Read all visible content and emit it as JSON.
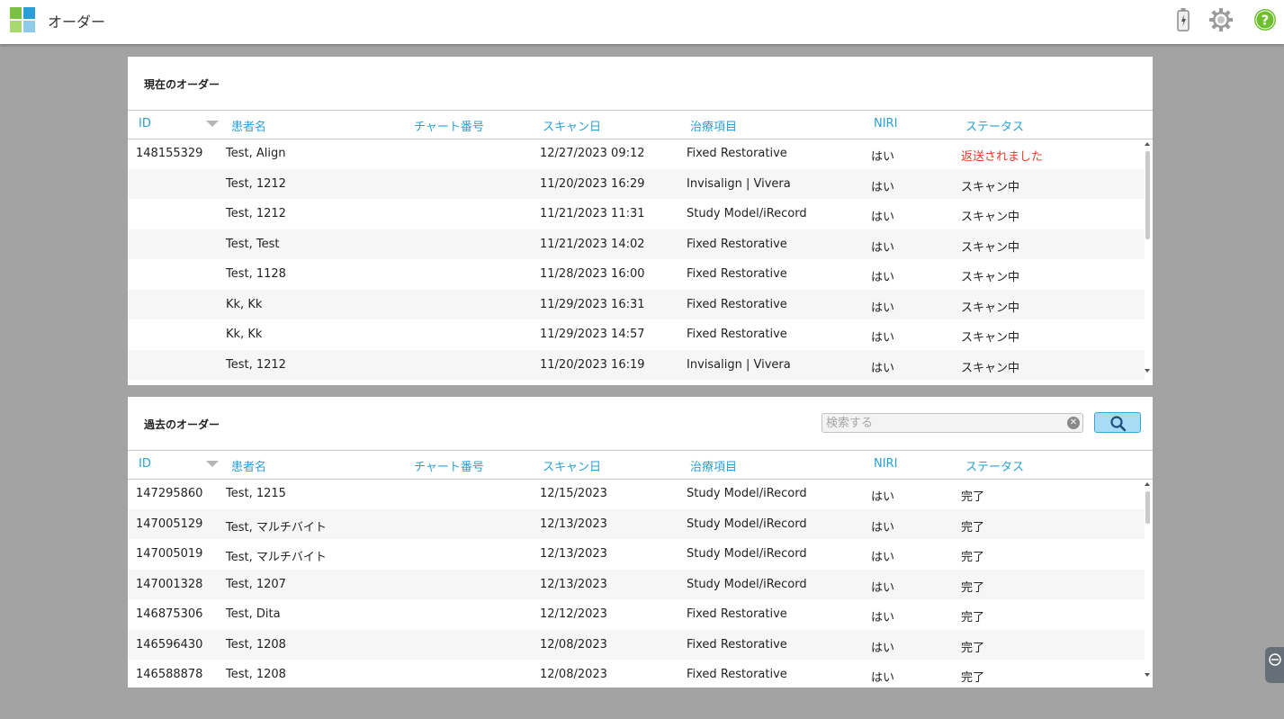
{
  "app": {
    "title": "オーダー",
    "logo_colors": [
      "#7ac143",
      "#2a9fd6",
      "#a8d86e",
      "#8dcbe9"
    ]
  },
  "toolbar": {
    "battery_icon": "battery-charging-icon",
    "settings_icon": "gear-icon",
    "help_icon": "help-icon",
    "help_color": "#6dbf2f"
  },
  "current_orders": {
    "title": "現在のオーダー",
    "columns": {
      "id": "ID",
      "name": "患者名",
      "chart": "チャート番号",
      "date": "スキャン日",
      "treatment": "治療項目",
      "niri": "NIRI",
      "status": "ステータス"
    },
    "rows": [
      {
        "id": "148155329",
        "name": "Test, Align",
        "chart": "",
        "date": "12/27/2023 09:12",
        "treatment": "Fixed Restorative",
        "niri": "はい",
        "status": "返送されました"
      },
      {
        "id": "",
        "name": "Test, 1212",
        "chart": "",
        "date": "11/20/2023 16:29",
        "treatment": "Invisalign | Vivera",
        "niri": "はい",
        "status": "スキャン中"
      },
      {
        "id": "",
        "name": "Test, 1212",
        "chart": "",
        "date": "11/21/2023 11:31",
        "treatment": "Study Model/iRecord",
        "niri": "はい",
        "status": "スキャン中"
      },
      {
        "id": "",
        "name": "Test, Test",
        "chart": "",
        "date": "11/21/2023 14:02",
        "treatment": "Fixed Restorative",
        "niri": "はい",
        "status": "スキャン中"
      },
      {
        "id": "",
        "name": "Test, 1128",
        "chart": "",
        "date": "11/28/2023 16:00",
        "treatment": "Fixed Restorative",
        "niri": "はい",
        "status": "スキャン中"
      },
      {
        "id": "",
        "name": "Kk, Kk",
        "chart": "",
        "date": "11/29/2023 16:31",
        "treatment": "Fixed Restorative",
        "niri": "はい",
        "status": "スキャン中"
      },
      {
        "id": "",
        "name": "Kk, Kk",
        "chart": "",
        "date": "11/29/2023 14:57",
        "treatment": "Fixed Restorative",
        "niri": "はい",
        "status": "スキャン中"
      },
      {
        "id": "",
        "name": "Test, 1212",
        "chart": "",
        "date": "11/20/2023 16:19",
        "treatment": "Invisalign | Vivera",
        "niri": "はい",
        "status": "スキャン中"
      }
    ]
  },
  "past_orders": {
    "title": "過去のオーダー",
    "search": {
      "placeholder": "検索する",
      "value": ""
    },
    "columns": {
      "id": "ID",
      "name": "患者名",
      "chart": "チャート番号",
      "date": "スキャン日",
      "treatment": "治療項目",
      "niri": "NIRI",
      "status": "ステータス"
    },
    "rows": [
      {
        "id": "147295860",
        "name": "Test, 1215",
        "chart": "",
        "date": "12/15/2023",
        "treatment": "Study Model/iRecord",
        "niri": "はい",
        "status": "完了"
      },
      {
        "id": "147005129",
        "name": "Test, マルチバイト",
        "chart": "",
        "date": "12/13/2023",
        "treatment": "Study Model/iRecord",
        "niri": "はい",
        "status": "完了"
      },
      {
        "id": "147005019",
        "name": "Test, マルチバイト",
        "chart": "",
        "date": "12/13/2023",
        "treatment": "Study Model/iRecord",
        "niri": "はい",
        "status": "完了"
      },
      {
        "id": "147001328",
        "name": "Test, 1207",
        "chart": "",
        "date": "12/13/2023",
        "treatment": "Study Model/iRecord",
        "niri": "はい",
        "status": "完了"
      },
      {
        "id": "146875306",
        "name": "Test, Dita",
        "chart": "",
        "date": "12/12/2023",
        "treatment": "Fixed Restorative",
        "niri": "はい",
        "status": "完了"
      },
      {
        "id": "146596430",
        "name": "Test, 1208",
        "chart": "",
        "date": "12/08/2023",
        "treatment": "Fixed Restorative",
        "niri": "はい",
        "status": "完了"
      },
      {
        "id": "146588878",
        "name": "Test, 1208",
        "chart": "",
        "date": "12/08/2023",
        "treatment": "Fixed Restorative",
        "niri": "はい",
        "status": "完了"
      }
    ]
  }
}
